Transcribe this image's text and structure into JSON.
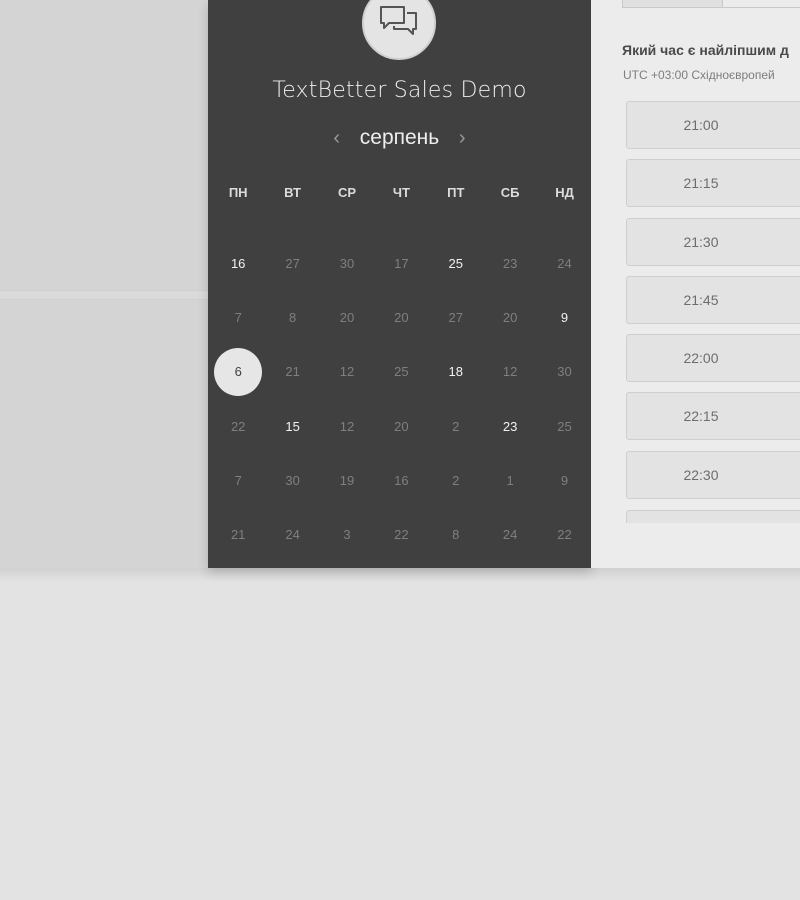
{
  "calendar": {
    "title": "TextBetter Sales Demo",
    "logo_icon": "chat-bubbles-icon",
    "month": "серпень",
    "prev_icon": "chevron-left-icon",
    "next_icon": "chevron-right-icon",
    "weekdays": [
      "ПН",
      "ВТ",
      "СР",
      "ЧТ",
      "ПТ",
      "СБ",
      "НД"
    ],
    "weeks": [
      [
        {
          "d": "16",
          "a": true
        },
        {
          "d": "27",
          "a": false
        },
        {
          "d": "30",
          "a": false
        },
        {
          "d": "17",
          "a": false
        },
        {
          "d": "25",
          "a": true
        },
        {
          "d": "23",
          "a": false
        },
        {
          "d": "24",
          "a": false
        }
      ],
      [
        {
          "d": "7",
          "a": false
        },
        {
          "d": "8",
          "a": false
        },
        {
          "d": "20",
          "a": false
        },
        {
          "d": "20",
          "a": false
        },
        {
          "d": "27",
          "a": false
        },
        {
          "d": "20",
          "a": false
        },
        {
          "d": "9",
          "a": true
        }
      ],
      [
        {
          "d": "6",
          "a": true,
          "s": true
        },
        {
          "d": "21",
          "a": false
        },
        {
          "d": "12",
          "a": false
        },
        {
          "d": "25",
          "a": false
        },
        {
          "d": "18",
          "a": true
        },
        {
          "d": "12",
          "a": false
        },
        {
          "d": "30",
          "a": false
        }
      ],
      [
        {
          "d": "22",
          "a": false
        },
        {
          "d": "15",
          "a": true
        },
        {
          "d": "12",
          "a": false
        },
        {
          "d": "20",
          "a": false
        },
        {
          "d": "2",
          "a": false
        },
        {
          "d": "23",
          "a": true
        },
        {
          "d": "25",
          "a": false
        }
      ],
      [
        {
          "d": "7",
          "a": false
        },
        {
          "d": "30",
          "a": false
        },
        {
          "d": "19",
          "a": false
        },
        {
          "d": "16",
          "a": false
        },
        {
          "d": "2",
          "a": false
        },
        {
          "d": "1",
          "a": false
        },
        {
          "d": "9",
          "a": false
        }
      ],
      [
        {
          "d": "21",
          "a": false
        },
        {
          "d": "24",
          "a": false
        },
        {
          "d": "3",
          "a": false
        },
        {
          "d": "22",
          "a": false
        },
        {
          "d": "8",
          "a": false
        },
        {
          "d": "24",
          "a": false
        },
        {
          "d": "22",
          "a": false
        }
      ]
    ]
  },
  "schedule": {
    "question": "Який час є найліпшим д",
    "timezone": "UTC +03:00 Східноєвропей",
    "slots": [
      "21:00",
      "21:15",
      "21:30",
      "21:45",
      "22:00",
      "22:15",
      "22:30"
    ]
  },
  "colors": {
    "panel_dark": "#404040",
    "selected_day": "#e6e6e6",
    "page_bg": "#e3e3e3"
  }
}
